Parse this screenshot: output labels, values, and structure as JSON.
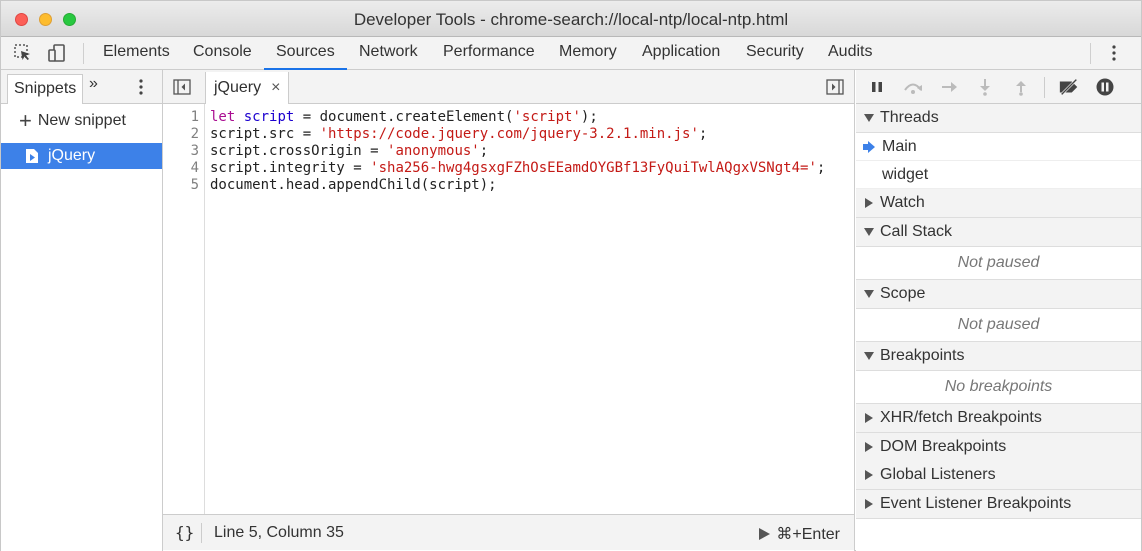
{
  "window": {
    "title": "Developer Tools - chrome-search://local-ntp/local-ntp.html"
  },
  "main_tabs": [
    {
      "label": "Elements"
    },
    {
      "label": "Console"
    },
    {
      "label": "Sources",
      "active": true
    },
    {
      "label": "Network"
    },
    {
      "label": "Performance"
    },
    {
      "label": "Memory"
    },
    {
      "label": "Application"
    },
    {
      "label": "Security"
    },
    {
      "label": "Audits"
    }
  ],
  "navigator": {
    "tab_label": "Snippets",
    "more_label": "»",
    "new_snippet_label": "New snippet",
    "snippets": [
      {
        "name": "jQuery",
        "selected": true
      }
    ]
  },
  "editor": {
    "tab": {
      "label": "jQuery",
      "close": "×"
    },
    "line_numbers": [
      "1",
      "2",
      "3",
      "4",
      "5"
    ],
    "code_lines": [
      "let script = document.createElement('script');",
      "script.src = 'https://code.jquery.com/jquery-3.2.1.min.js';",
      "script.crossOrigin = 'anonymous';",
      "script.integrity = 'sha256-hwg4gsxgFZhOsEEamdOYGBf13FyQuiTwlAQgxVSNgt4=';",
      "document.head.appendChild(script);"
    ],
    "status": {
      "format_label": "{}",
      "position": "Line 5, Column 35",
      "run_label": "⌘+Enter"
    }
  },
  "debugger": {
    "threads": {
      "title": "Threads",
      "items": [
        {
          "name": "Main",
          "current": true
        },
        {
          "name": "widget"
        }
      ]
    },
    "watch": {
      "title": "Watch"
    },
    "call_stack": {
      "title": "Call Stack",
      "empty": "Not paused"
    },
    "scope": {
      "title": "Scope",
      "empty": "Not paused"
    },
    "breakpoints": {
      "title": "Breakpoints",
      "empty": "No breakpoints"
    },
    "xhr": {
      "title": "XHR/fetch Breakpoints"
    },
    "dom": {
      "title": "DOM Breakpoints"
    },
    "global": {
      "title": "Global Listeners"
    },
    "event": {
      "title": "Event Listener Breakpoints"
    }
  },
  "colors": {
    "accent": "#1a73e8",
    "selection": "#3d81e8"
  }
}
